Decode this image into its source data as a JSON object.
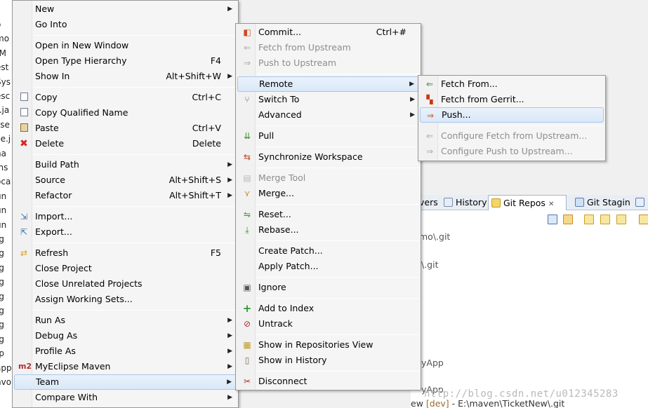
{
  "main_menu": {
    "items": [
      {
        "label": "New",
        "shortcut": "",
        "submenu": true
      },
      {
        "label": "Go Into",
        "shortcut": "",
        "submenu": false
      },
      {
        "label": "Open in New Window",
        "shortcut": "",
        "submenu": false
      },
      {
        "label": "Open Type Hierarchy",
        "shortcut": "F4",
        "submenu": false
      },
      {
        "label": "Show In",
        "shortcut": "Alt+Shift+W",
        "submenu": true
      },
      {
        "label": "Copy",
        "shortcut": "Ctrl+C",
        "submenu": false
      },
      {
        "label": "Copy Qualified Name",
        "shortcut": "",
        "submenu": false
      },
      {
        "label": "Paste",
        "shortcut": "Ctrl+V",
        "submenu": false
      },
      {
        "label": "Delete",
        "shortcut": "Delete",
        "submenu": false
      },
      {
        "label": "Build Path",
        "shortcut": "",
        "submenu": true
      },
      {
        "label": "Source",
        "shortcut": "Alt+Shift+S",
        "submenu": true
      },
      {
        "label": "Refactor",
        "shortcut": "Alt+Shift+T",
        "submenu": true
      },
      {
        "label": "Import...",
        "shortcut": "",
        "submenu": false
      },
      {
        "label": "Export...",
        "shortcut": "",
        "submenu": false
      },
      {
        "label": "Refresh",
        "shortcut": "F5",
        "submenu": false
      },
      {
        "label": "Close Project",
        "shortcut": "",
        "submenu": false
      },
      {
        "label": "Close Unrelated Projects",
        "shortcut": "",
        "submenu": false
      },
      {
        "label": "Assign Working Sets...",
        "shortcut": "",
        "submenu": false
      },
      {
        "label": "Run As",
        "shortcut": "",
        "submenu": true
      },
      {
        "label": "Debug As",
        "shortcut": "",
        "submenu": true
      },
      {
        "label": "Profile As",
        "shortcut": "",
        "submenu": true
      },
      {
        "label": "MyEclipse Maven",
        "shortcut": "",
        "submenu": true
      },
      {
        "label": "Team",
        "shortcut": "",
        "submenu": true
      },
      {
        "label": "Compare With",
        "shortcut": "",
        "submenu": true
      }
    ],
    "icons": {
      "myeclipse_maven": "m2"
    }
  },
  "team_menu": {
    "items": [
      {
        "label": "Commit...",
        "shortcut": "Ctrl+#"
      },
      {
        "label": "Fetch from Upstream",
        "shortcut": ""
      },
      {
        "label": "Push to Upstream",
        "shortcut": ""
      },
      {
        "label": "Remote",
        "shortcut": ""
      },
      {
        "label": "Switch To",
        "shortcut": ""
      },
      {
        "label": "Advanced",
        "shortcut": ""
      },
      {
        "label": "Pull",
        "shortcut": ""
      },
      {
        "label": "Synchronize Workspace",
        "shortcut": ""
      },
      {
        "label": "Merge Tool",
        "shortcut": ""
      },
      {
        "label": "Merge...",
        "shortcut": ""
      },
      {
        "label": "Reset...",
        "shortcut": ""
      },
      {
        "label": "Rebase...",
        "shortcut": ""
      },
      {
        "label": "Create Patch...",
        "shortcut": ""
      },
      {
        "label": "Apply Patch...",
        "shortcut": ""
      },
      {
        "label": "Ignore",
        "shortcut": ""
      },
      {
        "label": "Add to Index",
        "shortcut": ""
      },
      {
        "label": "Untrack",
        "shortcut": ""
      },
      {
        "label": "Show in Repositories View",
        "shortcut": ""
      },
      {
        "label": "Show in History",
        "shortcut": ""
      },
      {
        "label": "Disconnect",
        "shortcut": ""
      }
    ]
  },
  "remote_menu": {
    "items": [
      {
        "label": "Fetch From..."
      },
      {
        "label": "Fetch from Gerrit..."
      },
      {
        "label": "Push..."
      },
      {
        "label": "Configure Fetch from Upstream..."
      },
      {
        "label": "Configure Push to Upstream..."
      }
    ]
  },
  "background": {
    "tabs": [
      "vers",
      "History",
      "Git Repos",
      "Git Stagin"
    ],
    "tab_close": "✕",
    "repo_lines": [
      "mo\\.git",
      "\\.git",
      "yApp",
      "yApp"
    ],
    "bottom_path_prefix": "ew",
    "bottom_path_branch": "[dev]",
    "bottom_path_rest": "- E:\\maven\\TicketNew\\.git",
    "left_fragments": [
      "o",
      "mo",
      "[M",
      "est",
      "Sys",
      "esc",
      "t.ja",
      "sse",
      "ce.j",
      "ha",
      "Ins",
      "oca",
      "un",
      "un",
      "un",
      "-g",
      "-g",
      "-g",
      "-g",
      "-g",
      "-g",
      "-g",
      "-g",
      "-p",
      "app",
      "nvo"
    ],
    "watermark": "http://blog.csdn.net/u012345283"
  },
  "colors": {
    "highlight": "#d9e8f8",
    "disabled": "#8d8d8d",
    "branch": "#9a6b2f"
  }
}
